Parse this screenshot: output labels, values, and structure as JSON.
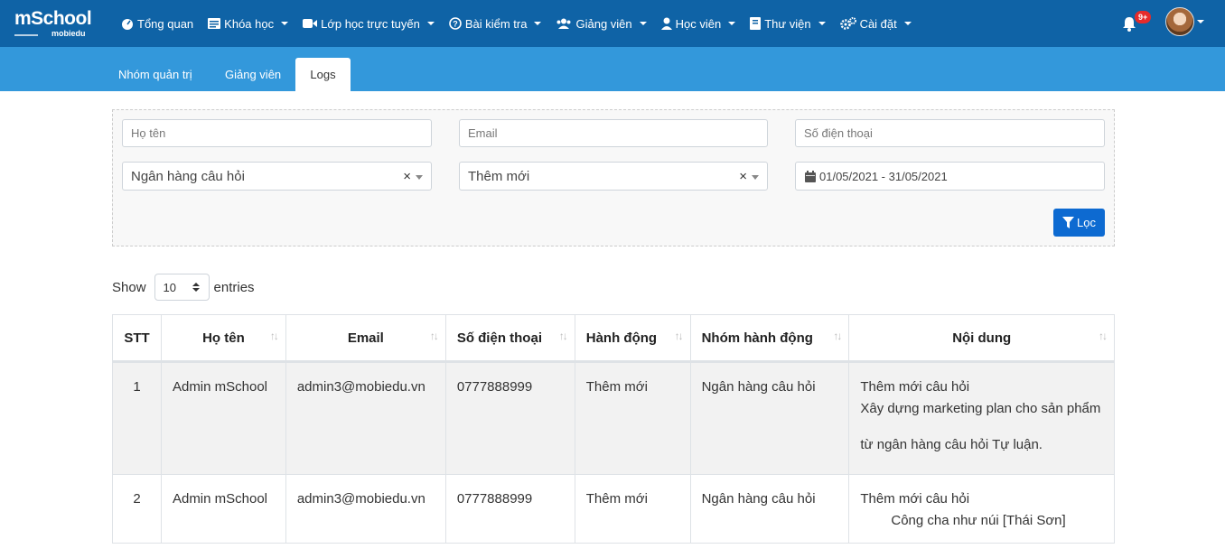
{
  "logo": {
    "main": "mSchool",
    "sub": "mobiedu"
  },
  "nav": [
    {
      "label": "Tổng quan",
      "icon": "dashboard-icon",
      "has_caret": false
    },
    {
      "label": "Khóa học",
      "icon": "course-icon",
      "has_caret": true
    },
    {
      "label": "Lớp học trực tuyến",
      "icon": "video-icon",
      "has_caret": true
    },
    {
      "label": "Bài kiểm tra",
      "icon": "question-circle-icon",
      "has_caret": true
    },
    {
      "label": "Giảng viên",
      "icon": "users-icon",
      "has_caret": true
    },
    {
      "label": "Học viên",
      "icon": "user-icon",
      "has_caret": true
    },
    {
      "label": "Thư viện",
      "icon": "book-icon",
      "has_caret": true
    },
    {
      "label": "Cài đặt",
      "icon": "cogs-icon",
      "has_caret": true
    }
  ],
  "notifications": {
    "badge": "9+"
  },
  "tabs": [
    {
      "label": "Nhóm quản trị",
      "active": false
    },
    {
      "label": "Giảng viên",
      "active": false
    },
    {
      "label": "Logs",
      "active": true
    }
  ],
  "filters": {
    "name_placeholder": "Họ tên",
    "email_placeholder": "Email",
    "phone_placeholder": "Số điện thoại",
    "group_value": "Ngân hàng câu hỏi",
    "action_value": "Thêm mới",
    "date_range": "01/05/2021 - 31/05/2021",
    "filter_button": "Lọc"
  },
  "entries": {
    "show_label": "Show",
    "value": "10",
    "entries_label": "entries"
  },
  "table": {
    "headers": [
      "STT",
      "Họ tên",
      "Email",
      "Số điện thoại",
      "Hành động",
      "Nhóm hành động",
      "Nội dung"
    ],
    "rows": [
      {
        "stt": "1",
        "name": "Admin mSchool",
        "email": "admin3@mobiedu.vn",
        "phone": "0777888999",
        "action": "Thêm mới",
        "group": "Ngân hàng câu hỏi",
        "content_line1": "Thêm mới câu hỏi",
        "content_line2": "Xây dựng marketing plan cho sản phẩm",
        "content_line3": "từ ngân hàng câu hỏi Tự luận."
      },
      {
        "stt": "2",
        "name": "Admin mSchool",
        "email": "admin3@mobiedu.vn",
        "phone": "0777888999",
        "action": "Thêm mới",
        "group": "Ngân hàng câu hỏi",
        "content_line1": "Thêm mới câu hỏi",
        "content_line2": "Công cha như núi [Thái Sơn]"
      }
    ]
  },
  "colors": {
    "navbar": "#0f63a6",
    "subnav": "#3398db",
    "button": "#0d6ad1",
    "badge": "#e62b2b"
  }
}
